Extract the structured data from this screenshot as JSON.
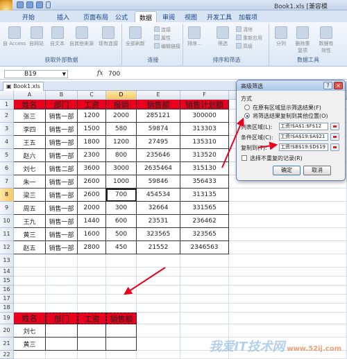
{
  "title_bar": {
    "title": "Book1.xls [兼容模"
  },
  "tabs": [
    {
      "label": "开始"
    },
    {
      "label": "插入"
    },
    {
      "label": "页面布局"
    },
    {
      "label": "公式"
    },
    {
      "label": "数据"
    },
    {
      "label": "审阅"
    },
    {
      "label": "视图"
    },
    {
      "label": "开发工具"
    },
    {
      "label": "加载项"
    }
  ],
  "active_tab": "数据",
  "ribbon": {
    "group_external": {
      "label": "获取外部数据",
      "buttons": [
        "自 Access",
        "自网站",
        "自文本",
        "自其他来源",
        "现有连接"
      ]
    },
    "group_connections": {
      "label": "连接",
      "big": "全部刷新",
      "small": [
        "连接",
        "属性",
        "编辑链接"
      ]
    },
    "group_sort": {
      "label": "排序和筛选",
      "buttons": [
        "排序...",
        "筛选"
      ],
      "small": [
        "清除",
        "重新应用",
        "高级"
      ]
    },
    "group_tools": {
      "label": "数据工具",
      "buttons": [
        "分列",
        "删除重复项",
        "数据有效性"
      ]
    }
  },
  "formula_bar": {
    "name_box": "B19",
    "fx": "fx",
    "value": "700"
  },
  "workbook_tab": "Book1.xls",
  "columns": [
    "A",
    "B",
    "C",
    "D",
    "E",
    "F"
  ],
  "rows": [
    "1",
    "2",
    "3",
    "4",
    "5",
    "6",
    "7",
    "8",
    "9",
    "10",
    "11",
    "12",
    "13",
    "14",
    "15",
    "16",
    "17",
    "18",
    "19",
    "20",
    "21",
    "22"
  ],
  "table": {
    "headers": [
      "姓名",
      "部门",
      "工资",
      "报销",
      "销售额",
      "销售计划额"
    ],
    "rows": [
      [
        "张三",
        "销售一部",
        "1200",
        "2000",
        "285121",
        "300000"
      ],
      [
        "李四",
        "销售一部",
        "1500",
        "580",
        "59874",
        "313303"
      ],
      [
        "王五",
        "销售一部",
        "1800",
        "1200",
        "27495",
        "135310"
      ],
      [
        "赵六",
        "销售一部",
        "2300",
        "800",
        "235646",
        "313520"
      ],
      [
        "刘七",
        "销售二部",
        "3600",
        "3000",
        "2635464",
        "315130"
      ],
      [
        "朱一",
        "销售一部",
        "2600",
        "1000",
        "59846",
        "356433"
      ],
      [
        "梁三",
        "销售一部",
        "2600",
        "700",
        "454534",
        "313135"
      ],
      [
        "周五",
        "销售一部",
        "2000",
        "300",
        "32664",
        "331565"
      ],
      [
        "王九",
        "销售一部",
        "1440",
        "600",
        "23531",
        "236462"
      ],
      [
        "黄三",
        "销售一部",
        "1600",
        "500",
        "323565",
        "323565"
      ],
      [
        "赵五",
        "销售一部",
        "2800",
        "450",
        "21552",
        "2346563"
      ]
    ]
  },
  "criteria": {
    "headers": [
      "姓名",
      "部门",
      "工资",
      "销售额"
    ],
    "rows": [
      [
        "刘七"
      ],
      [
        "黄三"
      ]
    ]
  },
  "dialog": {
    "title": "高级筛选",
    "help": "?",
    "close": "×",
    "method_label": "方式",
    "option1": "在原有区域显示筛选结果(F)",
    "option2": "将筛选结果复制到其他位置(O)",
    "list_range_label": "列表区域(L):",
    "list_range_value": "工资!$A$1:$F$12",
    "criteria_range_label": "条件区域(C):",
    "criteria_range_value": "工资!$A$19:$A$21",
    "copy_to_label": "复制到(T):",
    "copy_to_value": "工资!$B$19:$D$19",
    "unique_label": "选择不重复的记录(R)",
    "ok": "确定",
    "cancel": "取消"
  },
  "watermark": {
    "text": "我爱IT技术网",
    "url": "www.52ij.com"
  },
  "colors": {
    "header_red": "#e8001c",
    "ribbon_blue": "#15428b",
    "arrow_red": "#e8001c"
  }
}
